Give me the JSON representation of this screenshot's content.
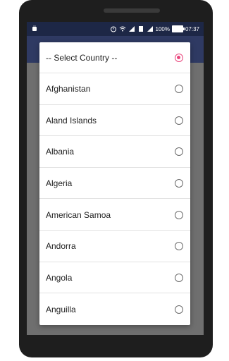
{
  "statusbar": {
    "left_icon": "android-icon",
    "battery_text": "100%",
    "time": "07:37",
    "icons": [
      "alarm-icon",
      "wifi-icon",
      "signal-icon",
      "sim-icon",
      "signal-icon",
      "battery-icon"
    ]
  },
  "dialog": {
    "items": [
      {
        "label": "-- Select Country --",
        "checked": true
      },
      {
        "label": "Afghanistan",
        "checked": false
      },
      {
        "label": "Aland Islands",
        "checked": false
      },
      {
        "label": "Albania",
        "checked": false
      },
      {
        "label": "Algeria",
        "checked": false
      },
      {
        "label": "American Samoa",
        "checked": false
      },
      {
        "label": "Andorra",
        "checked": false
      },
      {
        "label": "Angola",
        "checked": false
      },
      {
        "label": "Anguilla",
        "checked": false
      }
    ]
  },
  "colors": {
    "accent": "#e9457c",
    "statusbar": "#1d2746",
    "appbar": "#2f3a63"
  }
}
